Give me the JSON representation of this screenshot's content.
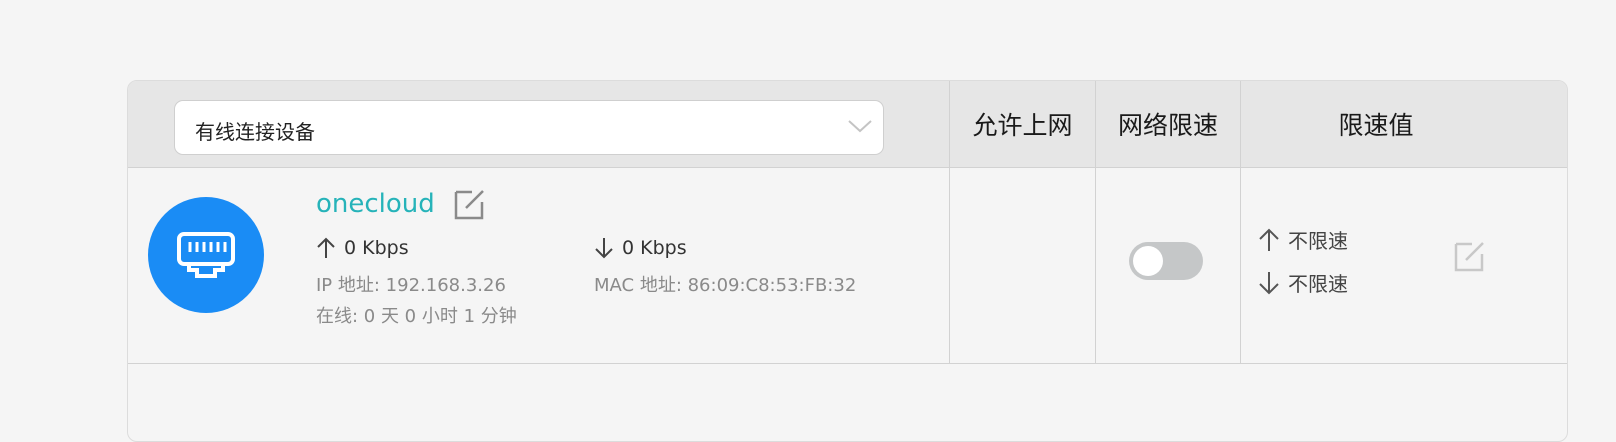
{
  "header": {
    "device_type_select": "有线连接设备",
    "col_allow_internet": "允许上网",
    "col_speed_limit": "网络限速",
    "col_limit_value": "限速值"
  },
  "device": {
    "name": "onecloud",
    "icon": "ethernet-port-icon",
    "upload_speed": "0 Kbps",
    "download_speed": "0 Kbps",
    "ip": "IP 地址: 192.168.3.26",
    "mac": "MAC 地址: 86:09:C8:53:FB:32",
    "online": "在线: 0 天 0 小时 1 分钟",
    "speed_limit_enabled": false,
    "upload_limit": "不限速",
    "download_limit": "不限速"
  },
  "colors": {
    "accent_blue": "#1a8cf5",
    "device_name_teal": "#26b3b9",
    "toggle_off": "#c5c7c8"
  }
}
